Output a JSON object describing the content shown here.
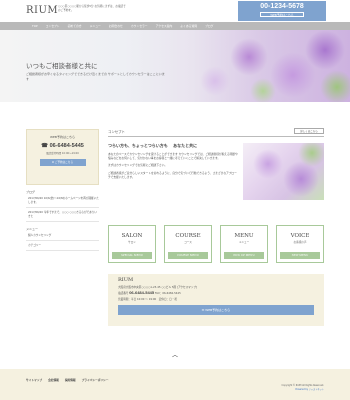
{
  "header": {
    "logo": "RIUM",
    "tagline": "○○○区○○○○駅から徒歩5分 お気軽にまずは、お電話でのご予約を。",
    "phone": "00-1234-5678",
    "phone_button": "WEB予約はこちら"
  },
  "nav": [
    "TOP",
    "コンセプト",
    "初めての方",
    "メニュー",
    "お問合わせ",
    "カウンセラー",
    "アクセス案内",
    "よくある質問",
    "ブログ"
  ],
  "hero": {
    "title": "いつもご相談者様と共に",
    "desc": "ご相談者様がお辛くなるタイミングでできるだけ近くまでの サポートとしてカウンセラーはここにいます"
  },
  "sidebar": {
    "box_title": "WEB予約はこちら",
    "phone": "06-6484-5445",
    "hours": "電話受付時間 10:00〜19:00",
    "reserve_button": "ご予約はこちら",
    "blog_heading": "ブログ",
    "blog_items": [
      "2017/06/20 10/6(金)〜10/8のホームページを再び開催いたします。",
      "2017/06/20 今年ですまで、○○○ ○○○きる心がでありいきた"
    ],
    "menu_heading": "メニュー",
    "menu_items": [
      "個人カウンセリング"
    ],
    "menu_more": "カテゴリー"
  },
  "concept": {
    "title": "コンセプト",
    "more_button": "詳しくはこちら",
    "headline": "つらい方も、ちょっとつらい方も 　あなたと共に",
    "p1": "あなたのペースでカウンセリングを受けることができます カウンセリングでは、ご相談者様が抱える問題や悩みなどをお伺いして、気付かない事をお客様と一緒に考えていくことで解決していきます。",
    "p2": "まずはカウンセリングでお気軽にご相談下さい。",
    "p3": "ご相談者様がご自分らしいスタートを切れるように、自分で気づいて行動できるよう、さまざまなアプローチで支援いたします。"
  },
  "cards": [
    {
      "en": "SALON",
      "ja": "サロン",
      "sub": "SPECIAL MENU"
    },
    {
      "en": "COURSE",
      "ja": "コース",
      "sub": "COURSE MENU"
    },
    {
      "en": "MENU",
      "ja": "メニュー",
      "sub": "PICK UP MENU"
    },
    {
      "en": "VOICE",
      "ja": "お客様の声",
      "sub": "NEW MENU"
    }
  ],
  "footer_info": {
    "name": "RIUM",
    "address": "大阪府大阪市中央区○○○○1-23-45 ○○ビル 5階 [アクセスマップ]",
    "tel_label": "電話番号",
    "tel": "06-6484-5445",
    "fax": "FAX：06-6484-5445",
    "hours": "営業時間：平日 10:00 〜 19:00　定休日：日・祝",
    "web_button": "WEB予約はこちら"
  },
  "footer": {
    "scroll_top": "︿",
    "links": [
      "サイトマップ",
      "会社情報",
      "採用情報",
      "プライバシーポリシー"
    ],
    "copyright": "Copyright © RIUM All Rights Reserved.",
    "powered": "Powered by ジャストネット"
  }
}
